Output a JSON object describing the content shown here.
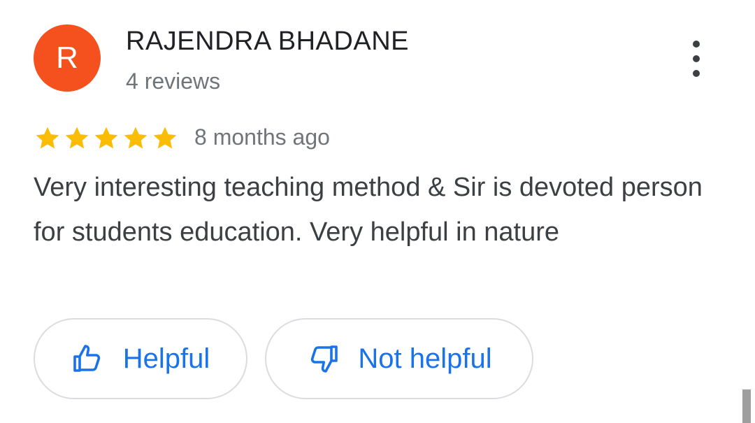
{
  "review": {
    "avatar_letter": "R",
    "avatar_color": "#f4511e",
    "author": "RAJENDRA BHADANE",
    "author_reviews": "4 reviews",
    "rating": 5,
    "rating_max": 5,
    "star_color": "#fbbc04",
    "date": "8 months ago",
    "text": "Very interesting teaching method & Sir is devoted person for students education. Very helpful in nature",
    "menu_icon": "more-vert-icon"
  },
  "actions": {
    "helpful_label": "Helpful",
    "helpful_icon": "thumb-up-icon",
    "not_helpful_label": "Not helpful",
    "not_helpful_icon": "thumb-down-icon",
    "accent_color": "#1a73e8"
  }
}
